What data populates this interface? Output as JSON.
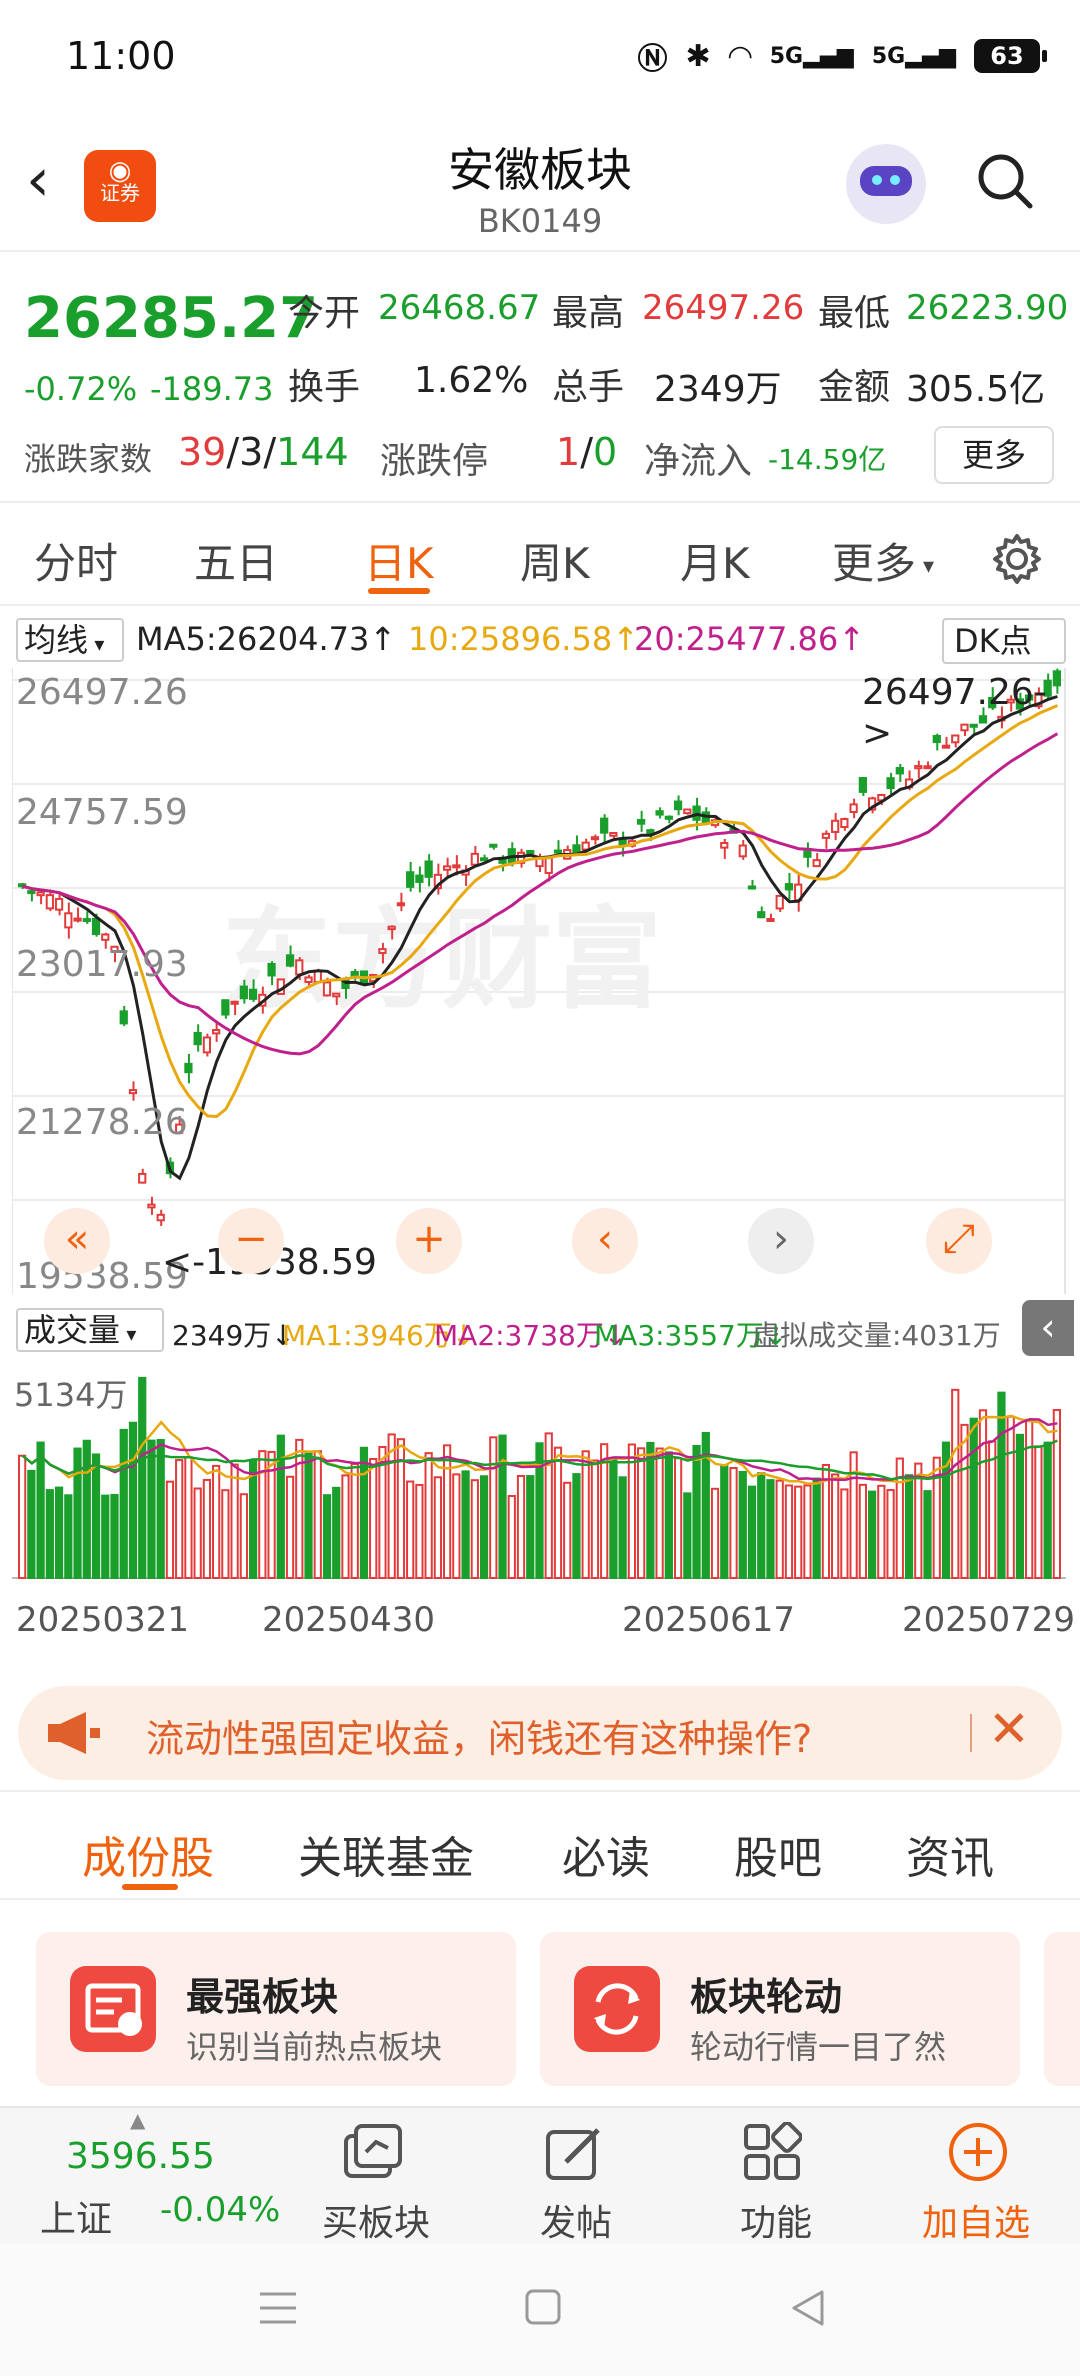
{
  "status": {
    "time": "11:00",
    "battery": "63",
    "signal1": "5G",
    "signal2": "5G"
  },
  "header": {
    "title": "安徽板块",
    "code": "BK0149",
    "logo_label": "证券"
  },
  "quote": {
    "price": "26285.27",
    "change_pct": "-0.72%",
    "change_val": "-189.73",
    "open_label": "今开",
    "open": "26468.67",
    "high_label": "最高",
    "high": "26497.26",
    "low_label": "最低",
    "low": "26223.90",
    "turnover_label": "换手",
    "turnover": "1.62%",
    "volume_label": "总手",
    "volume": "2349万",
    "amount_label": "金额",
    "amount": "305.5亿",
    "breadth_label": "涨跌家数",
    "breadth_up": "39",
    "breadth_flat": "3",
    "breadth_down": "144",
    "limit_label": "涨跌停",
    "limit_up": "1",
    "limit_down": "0",
    "netflow_label": "净流入",
    "netflow": "-14.59亿",
    "more": "更多"
  },
  "tabs": [
    "分时",
    "五日",
    "日K",
    "周K",
    "月K",
    "更多"
  ],
  "ma": {
    "selector": "均线",
    "ma5": "MA5:26204.73",
    "ma10": "10:25896.58",
    "ma20": "20:25477.86",
    "dk": "DK点",
    "colors": {
      "ma5": "#222222",
      "ma10": "#e8a810",
      "ma20": "#c0208c"
    }
  },
  "kchart": {
    "price_labels": [
      "26497.26",
      "24757.59",
      "23017.93",
      "21278.26",
      "19538.59"
    ],
    "max_marker": "26497.26->",
    "min_marker": "<-19538.59",
    "watermark": "东方财富"
  },
  "vol": {
    "selector": "成交量",
    "current": "2349万",
    "ma1": "MA1:3946万",
    "ma2": "MA2:3738万",
    "ma3": "MA3:3557万",
    "virtual": "虚拟成交量:4031万",
    "max_label": "5134万"
  },
  "dates": [
    "20250321",
    "20250430",
    "20250617",
    "20250729"
  ],
  "banner": {
    "text": "流动性强固定收益，闲钱还有这种操作?"
  },
  "subtabs": [
    "成份股",
    "关联基金",
    "必读",
    "股吧",
    "资讯"
  ],
  "cards": [
    {
      "title": "最强板块",
      "subtitle": "识别当前热点板块"
    },
    {
      "title": "板块轮动",
      "subtitle": "轮动行情一目了然"
    }
  ],
  "bottom": {
    "index_value": "3596.55",
    "index_name": "上证",
    "index_change": "-0.04%",
    "buy": "买板块",
    "post": "发帖",
    "func": "功能",
    "add": "加自选"
  }
}
